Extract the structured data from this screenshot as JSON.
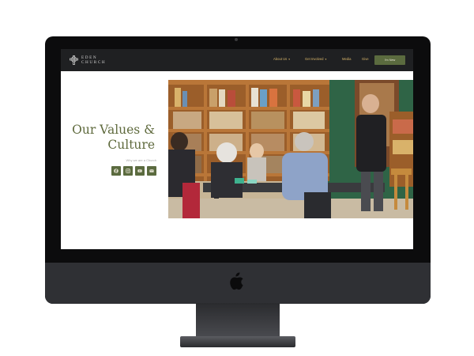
{
  "site": {
    "logo_line1": "EDEN",
    "logo_line2": "CHURCH",
    "nav": [
      {
        "label": "About Us",
        "caret": "▾"
      },
      {
        "label": "Get Involved",
        "caret": "▾"
      },
      {
        "label": "Media"
      },
      {
        "label": "Give"
      }
    ],
    "cta_label": "I'm New"
  },
  "hero": {
    "title_line1": "Our Values &",
    "title_line2": "Culture",
    "subtitle": "Why we are a Church",
    "socials": [
      "facebook-icon",
      "instagram-icon",
      "youtube-icon",
      "email-icon"
    ]
  },
  "colors": {
    "accent_green": "#5b6b3f",
    "nav_gold": "#d8b56a",
    "header_bg": "#1f2022",
    "title_green": "#5f6a3d"
  }
}
